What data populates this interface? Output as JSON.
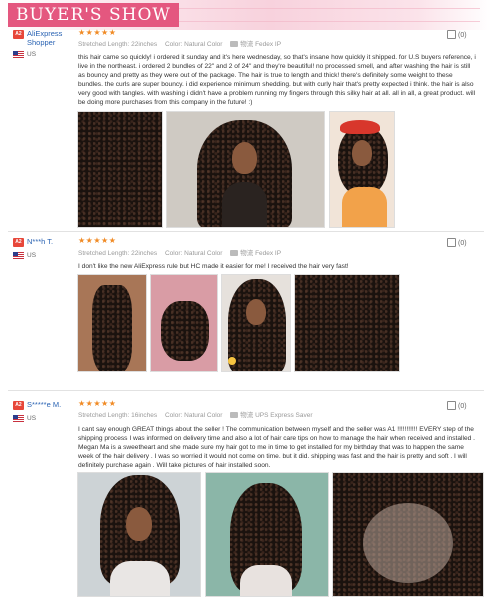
{
  "banner": {
    "title": "BUYER'S SHOW"
  },
  "labels": {
    "stretched_length": "Stretched Length:",
    "color": "Color:",
    "ships_from": "物流"
  },
  "reviews": [
    {
      "badge": "A2",
      "name_line1": "AliExpress",
      "name_line2": "Shopper",
      "country": "US",
      "stars": "★★★★★",
      "length": "22inches",
      "color": "Natural Color",
      "shipping": "Fedex IP",
      "helpful": "(0)",
      "text": "this hair came so quickly! i ordered it sunday and it's here wednesday, so that's insane how quickly it shipped. for U.S buyers reference, i live in the northeast. i ordered 2 bundles of 22\" and 2 of 24\" and they're beautiful! no processed smell, and after washing the hair is still as bouncy and pretty as they were out of the package. The hair is true to length and thick! there's definitely some weight to these bundles. the curls are super bouncy. i did experience minimum shedding. but with curly hair that's pretty expected i think. the hair is also very good with tangles. with washing i didn't have a problem running my fingers through this silky hair at all. all in all, a great product. will be doing more purchases from this company in the future! :)"
    },
    {
      "badge": "A2",
      "name_line1": "N***h T.",
      "country": "US",
      "stars": "★★★★★",
      "length": "22inches",
      "color": "Natural Color",
      "shipping": "Fedex IP",
      "helpful": "(0)",
      "text": "I don't like the new AliExpress rule but HC made it easier for me! I received the hair very fast!"
    },
    {
      "badge": "A2",
      "name_line1": "S*****e M.",
      "country": "US",
      "stars": "★★★★★",
      "length": "16inches",
      "color": "Natural Color",
      "shipping": "UPS Express Saver",
      "helpful": "(0)",
      "text": "I cant say enough GREAT things about the seller ! The communication between myself and the seller was A1 !!!!!!!!!!! EVERY step of the shipping process I was informed on delivery time and also a lot of hair care tips on how to manage the hair when received and installed . Megan Ma is a sweetheart and she made sure my hair got to me in time to get installed for my birthday that was to happen the same week of the hair delivery . I was so worried it would not come on time. but it did. shipping was fast and the hair is pretty and soft . I will definitely purchase again . Will take pictures of hair installed soon."
    }
  ]
}
